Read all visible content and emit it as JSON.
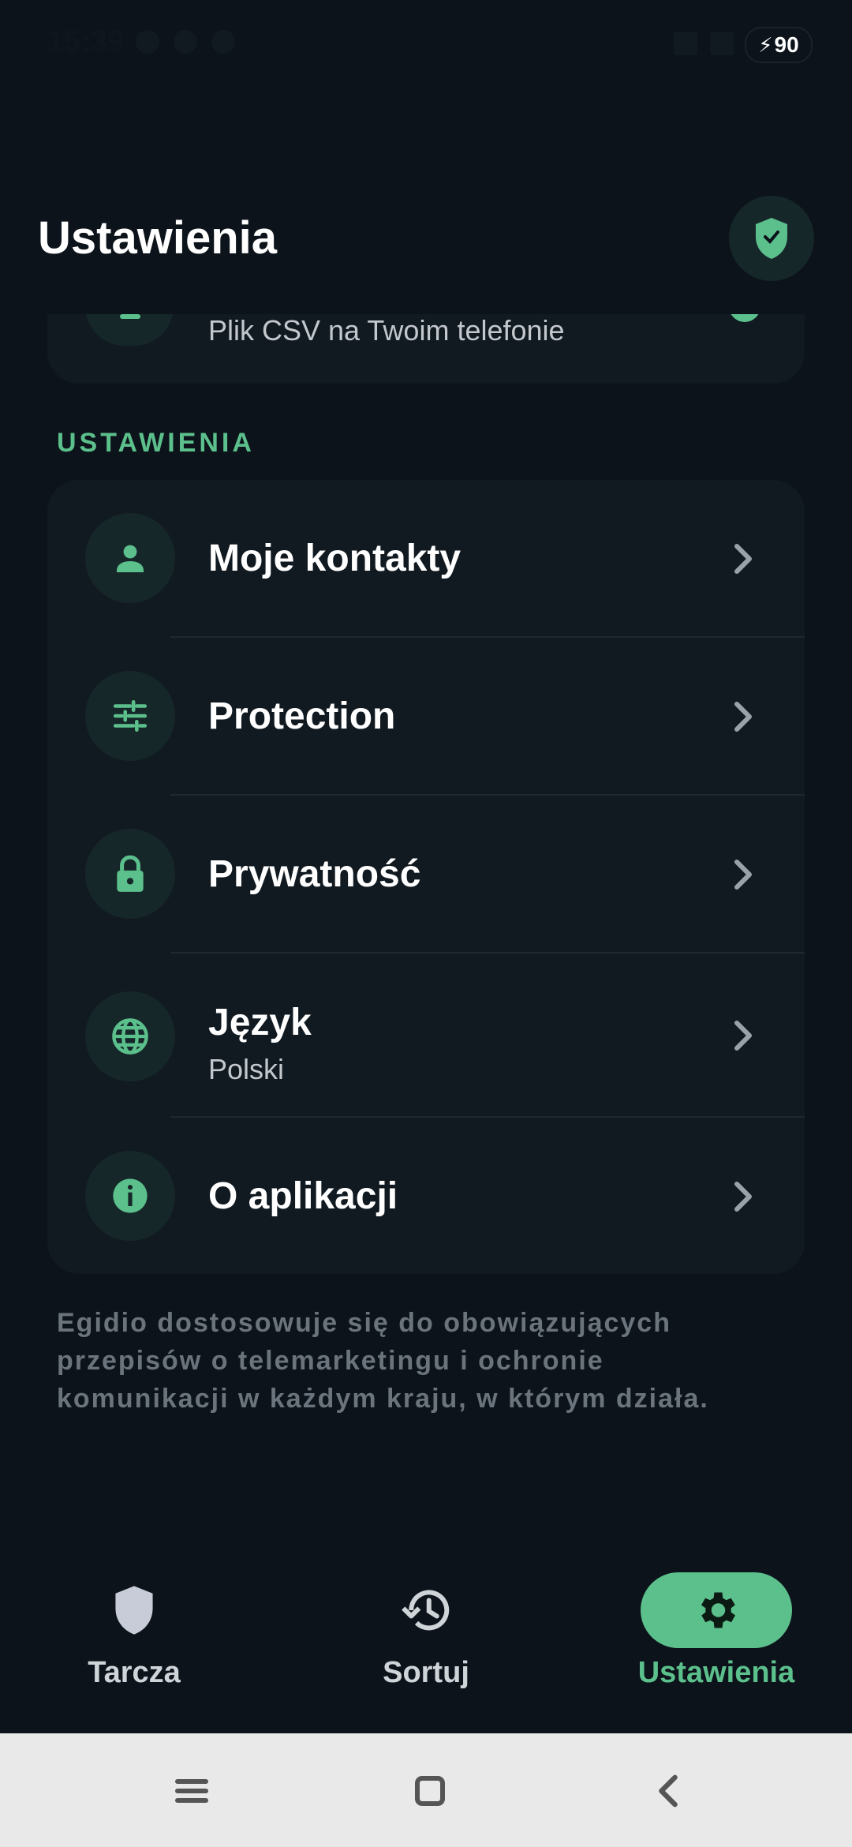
{
  "status_bar": {
    "time": "15:39",
    "battery": "90"
  },
  "header": {
    "title": "Ustawienia"
  },
  "clipped_item": {
    "subtitle": "Plik CSV na Twoim telefonie"
  },
  "section": {
    "label": "USTAWIENIA"
  },
  "settings": {
    "items": [
      {
        "label": "Moje kontakty",
        "icon": "person-icon"
      },
      {
        "label": "Protection",
        "icon": "tune-icon"
      },
      {
        "label": "Prywatność",
        "icon": "lock-icon"
      },
      {
        "label": "Język",
        "sublabel": "Polski",
        "icon": "globe-icon"
      },
      {
        "label": "O aplikacji",
        "icon": "info-icon"
      }
    ]
  },
  "footer": {
    "text": "Egidio dostosowuje się do obowiązujących przepisów o telemarketingu i ochronie komunikacji w każdym kraju, w którym działa."
  },
  "bottom_nav": {
    "items": [
      {
        "label": "Tarcza",
        "icon": "shield-icon"
      },
      {
        "label": "Sortuj",
        "icon": "history-icon"
      },
      {
        "label": "Ustawienia",
        "icon": "gear-icon",
        "active": true
      }
    ]
  },
  "colors": {
    "background": "#0c131a",
    "card": "#111a21",
    "accent": "#5cc08c",
    "icon_circle": "#16272a",
    "muted_text": "#6b747c"
  }
}
